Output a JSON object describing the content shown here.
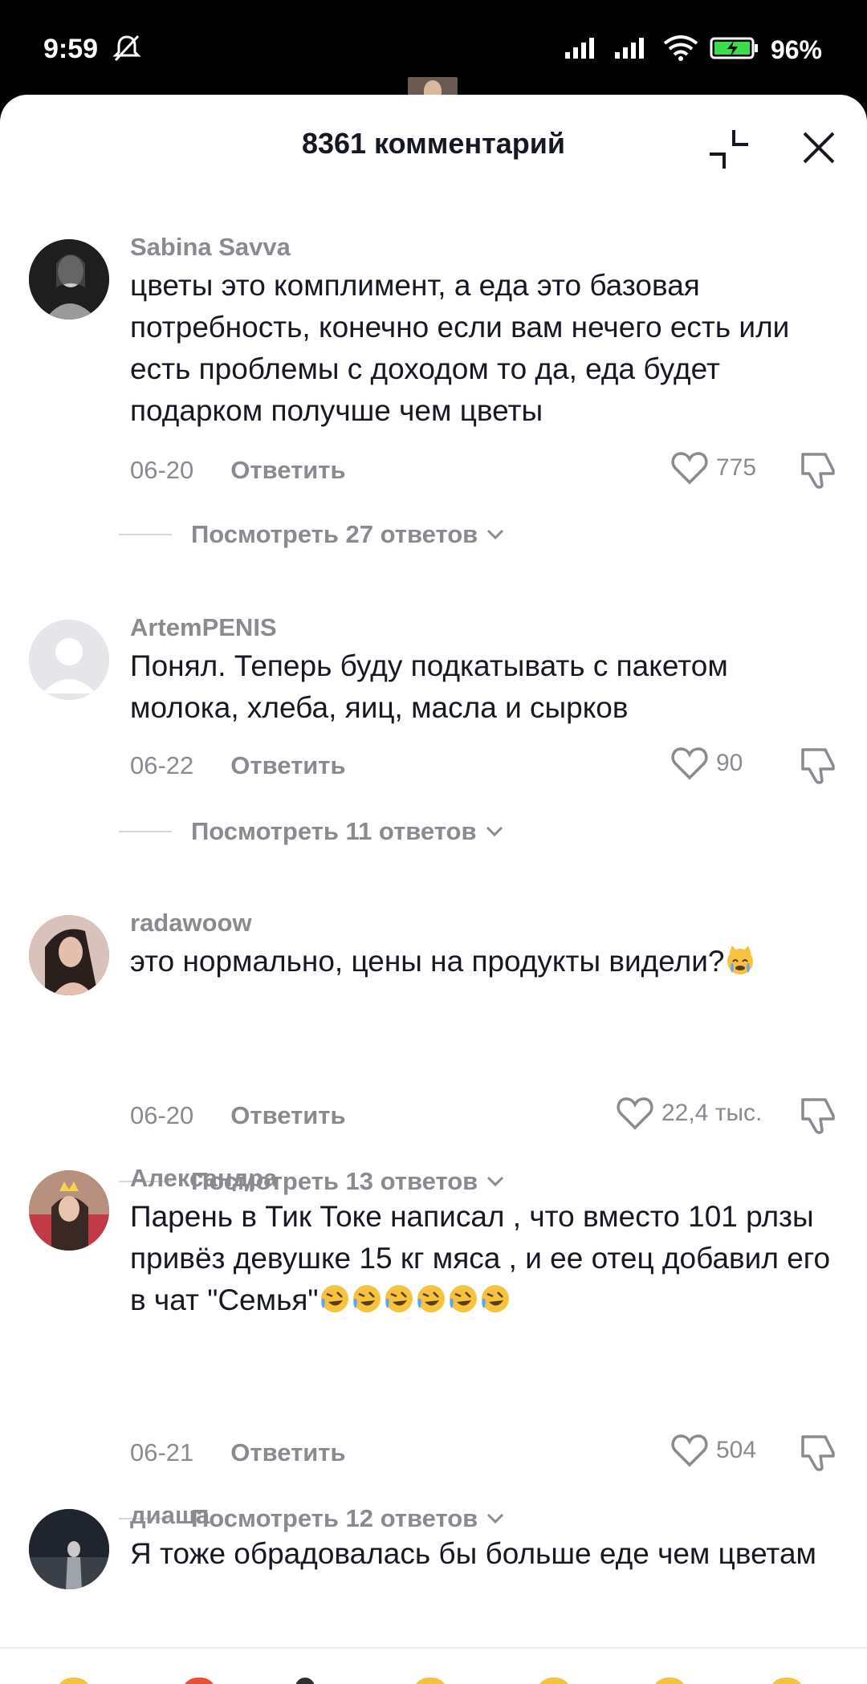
{
  "status_bar": {
    "time": "9:59",
    "battery": "96%"
  },
  "header": {
    "title": "8361 комментарий",
    "collapse_icon": "collapse-icon",
    "close_icon": "close-icon"
  },
  "comments": [
    {
      "author": "Sabina Savva",
      "text": "цветы это комплимент, а еда это базовая потребность, конечно если вам нечего есть или есть проблемы с доходом то да, еда будет подарком получше чем цветы",
      "date": "06-20",
      "reply_label": "Ответить",
      "likes": "775",
      "replies_label": "Посмотреть 27 ответов"
    },
    {
      "author": "ArtemPENIS",
      "text": "Понял. Теперь буду подкатывать с пакетом молока, хлеба, яиц, масла и сырков",
      "date": "06-22",
      "reply_label": "Ответить",
      "likes": "90",
      "replies_label": "Посмотреть 11 ответов"
    },
    {
      "author": "radawoow",
      "text": "это нормально, цены на продукты видели?",
      "emoji": "crying-cat-emoji",
      "date": "06-20",
      "reply_label": "Ответить",
      "likes": "22,4 тыс.",
      "replies_label": "Посмотреть 13 ответов"
    },
    {
      "author": "Александра",
      "text": "Парень в Тик Токе написал , что вместо 101 рлзы привёз девушке 15 кг мяса , и ее отец добавил его в чат \"Семья\"",
      "emoji": "rofl-emoji",
      "date": "06-21",
      "reply_label": "Ответить",
      "likes": "504",
      "replies_label": "Посмотреть 12 ответов"
    },
    {
      "author": "диаша",
      "text": "Я тоже обрадовалась бы больше еде чем цветам"
    }
  ],
  "colors": {
    "text_primary": "#161823",
    "text_secondary": "#8a8b91",
    "background": "#ffffff"
  }
}
